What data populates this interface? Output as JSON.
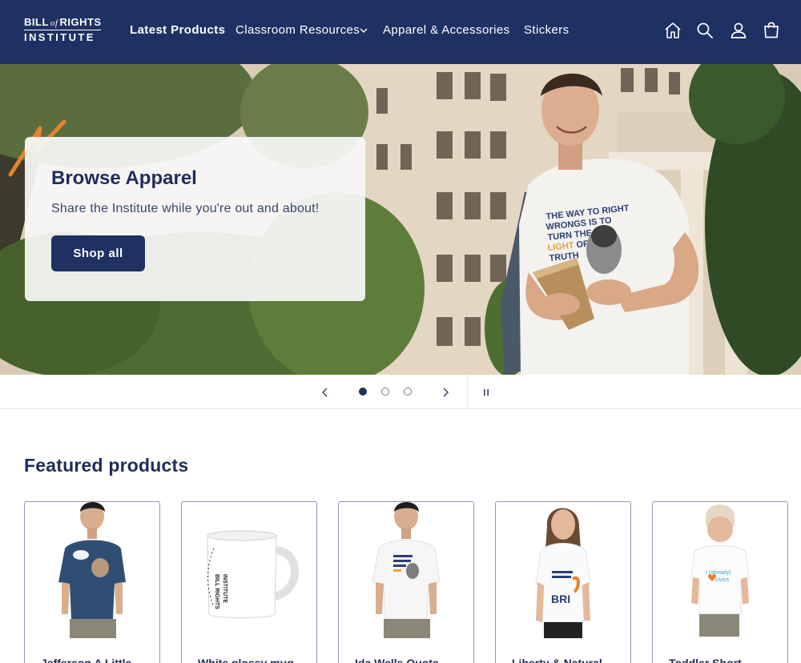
{
  "logo": {
    "line1_a": "BILL",
    "line1_of": "of",
    "line1_b": "RIGHTS",
    "line2": "INSTITUTE"
  },
  "nav": {
    "items": [
      {
        "label": "Latest Products"
      },
      {
        "label": "Classroom Resources"
      },
      {
        "label": "Apparel & Accessories"
      },
      {
        "label": "Stickers"
      }
    ],
    "icons": [
      "home-icon",
      "search-icon",
      "account-icon",
      "cart-icon"
    ]
  },
  "hero": {
    "title": "Browse Apparel",
    "subtitle": "Share the Institute while you're out and about!",
    "button_label": "Shop all",
    "shirt_text": {
      "line1": "THE WAY TO RIGHT",
      "line2": "WRONGS IS TO",
      "line3": "TURN THE",
      "line4_a": "LIGHT",
      "line4_b": " OF",
      "line5": "TRUTH"
    }
  },
  "slider": {
    "total_slides": 3,
    "current_slide": 1,
    "prev_icon": "chevron-left-icon",
    "next_icon": "chevron-right-icon",
    "pause_icon": "pause-icon"
  },
  "featured": {
    "title": "Featured products",
    "products": [
      {
        "title": "Jefferson A Little"
      },
      {
        "title": "White glossy mug"
      },
      {
        "title": "Ida Wells Quote"
      },
      {
        "title": "Liberty & Natural"
      },
      {
        "title": "Toddler Short"
      }
    ],
    "mini_prints": {
      "toddler_line1": "I (already)",
      "toddler_line2": "civics",
      "liberty_word": "BRI"
    }
  },
  "colors": {
    "navy": "#1f3163",
    "accent_orange": "#e8822e",
    "text_navy": "#1f2d5c"
  }
}
